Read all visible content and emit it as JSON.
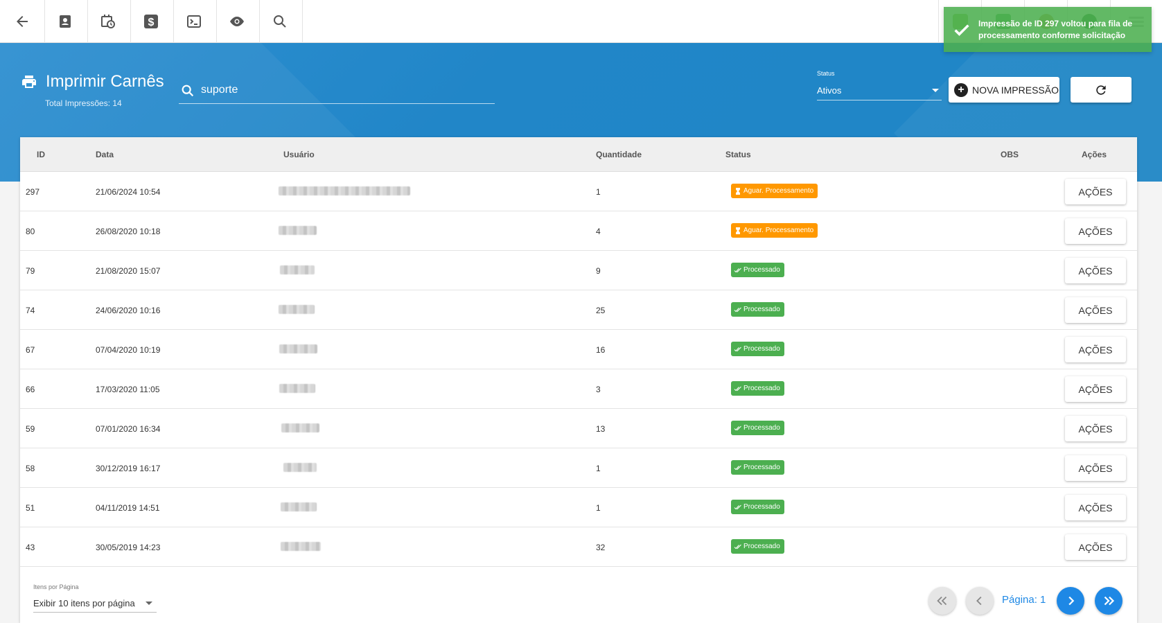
{
  "toolbar": {
    "icons": [
      "back-arrow-icon",
      "contact-icon",
      "calendar-clock-icon",
      "dollar-icon",
      "terminal-icon",
      "eye-icon",
      "search-icon"
    ]
  },
  "toast": {
    "line1": "Impressão de ID 297 voltou para fila de",
    "line2": "processamento conforme solicitação"
  },
  "header": {
    "title": "Imprimir Carnês",
    "total": "Total Impressões: 14",
    "search_value": "suporte",
    "status_label": "Status",
    "status_value": "Ativos",
    "new_button": "NOVA IMPRESSÃO"
  },
  "table": {
    "columns": {
      "id": "ID",
      "data": "Data",
      "usuario": "Usuário",
      "quantidade": "Quantidade",
      "status": "Status",
      "obs": "OBS",
      "acoes": "Ações"
    },
    "rows": [
      {
        "id": "297",
        "data": "21/06/2024 10:54",
        "quantidade": "1",
        "status": "Aguar. Processamento",
        "acao": "AÇÕES"
      },
      {
        "id": "80",
        "data": "26/08/2020 10:18",
        "quantidade": "4",
        "status": "Aguar. Processamento",
        "acao": "AÇÕES"
      },
      {
        "id": "79",
        "data": "21/08/2020 15:07",
        "quantidade": "9",
        "status": "Processado",
        "acao": "AÇÕES"
      },
      {
        "id": "74",
        "data": "24/06/2020 10:16",
        "quantidade": "25",
        "status": "Processado",
        "acao": "AÇÕES"
      },
      {
        "id": "67",
        "data": "07/04/2020 10:19",
        "quantidade": "16",
        "status": "Processado",
        "acao": "AÇÕES"
      },
      {
        "id": "66",
        "data": "17/03/2020 11:05",
        "quantidade": "3",
        "status": "Processado",
        "acao": "AÇÕES"
      },
      {
        "id": "59",
        "data": "07/01/2020 16:34",
        "quantidade": "13",
        "status": "Processado",
        "acao": "AÇÕES"
      },
      {
        "id": "58",
        "data": "30/12/2019 16:17",
        "quantidade": "1",
        "status": "Processado",
        "acao": "AÇÕES"
      },
      {
        "id": "51",
        "data": "04/11/2019 14:51",
        "quantidade": "1",
        "status": "Processado",
        "acao": "AÇÕES"
      },
      {
        "id": "43",
        "data": "30/05/2019 14:23",
        "quantidade": "32",
        "status": "Processado",
        "acao": "AÇÕES"
      }
    ]
  },
  "footer": {
    "perpage_label": "Itens por Página",
    "perpage_value": "Exibir 10 itens por página",
    "page_label": "Página: 1"
  },
  "colors": {
    "header_blue": "#2186c8",
    "badge_wait": "#ff9800",
    "badge_ok": "#4caf50",
    "toast_green": "#4caf50",
    "pager_active": "#1e88e5"
  }
}
